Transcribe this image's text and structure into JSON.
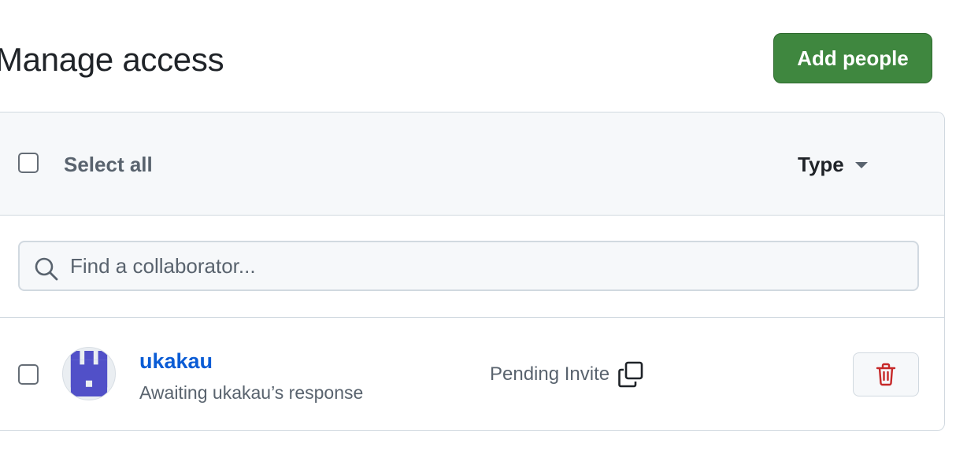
{
  "header": {
    "title": "Manage access",
    "add_button_label": "Add people"
  },
  "toolbar": {
    "select_all_label": "Select all",
    "type_filter_label": "Type"
  },
  "search": {
    "placeholder": "Find a collaborator...",
    "value": ""
  },
  "members": [
    {
      "username": "ukakau",
      "status_text": "Awaiting ukakau’s response",
      "role_label": "Pending Invite",
      "avatar_color": "#5150c8"
    }
  ],
  "colors": {
    "primary_button": "#3f873f",
    "link": "#0b5cd5",
    "danger": "#c62828"
  },
  "icons": [
    "search-icon",
    "chevron-down-icon",
    "copy-icon",
    "trash-icon",
    "identicon-avatar"
  ]
}
